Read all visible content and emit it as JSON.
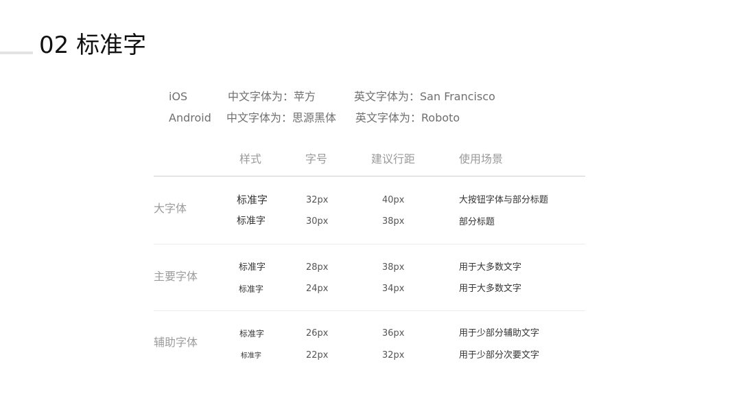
{
  "header": {
    "title": "02 标准字"
  },
  "platforms": [
    {
      "name": "iOS",
      "chinese_font": "中文字体为：苹方",
      "english_font": "英文字体为：San Francisco"
    },
    {
      "name": "Android",
      "chinese_font": "中文字体为：思源黑体",
      "english_font": "英文字体为：Roboto"
    }
  ],
  "table": {
    "columns": [
      "样式",
      "字号",
      "建议行距",
      "使用场景"
    ],
    "groups": [
      {
        "label": "大字体",
        "rows": [
          {
            "style": "标准字",
            "size": "32px",
            "line_height": "40px",
            "usage": "大按钮字体与部分标题"
          },
          {
            "style": "标准字",
            "size": "30px",
            "line_height": "38px",
            "usage": "部分标题"
          }
        ]
      },
      {
        "label": "主要字体",
        "rows": [
          {
            "style": "标准字",
            "size": "28px",
            "line_height": "38px",
            "usage": "用于大多数文字"
          },
          {
            "style": "标准字",
            "size": "24px",
            "line_height": "34px",
            "usage": "用于大多数文字"
          }
        ]
      },
      {
        "label": "辅助字体",
        "rows": [
          {
            "style": "标准字",
            "size": "26px",
            "line_height": "36px",
            "usage": "用于少部分辅助文字"
          },
          {
            "style": "标准字",
            "size": "22px",
            "line_height": "32px",
            "usage": "用于少部分次要文字"
          }
        ]
      }
    ]
  },
  "colors": {
    "title": "#111111",
    "body_text": "#333333",
    "muted_text": "#9a9a9a",
    "rule": "#cfcfcf"
  }
}
